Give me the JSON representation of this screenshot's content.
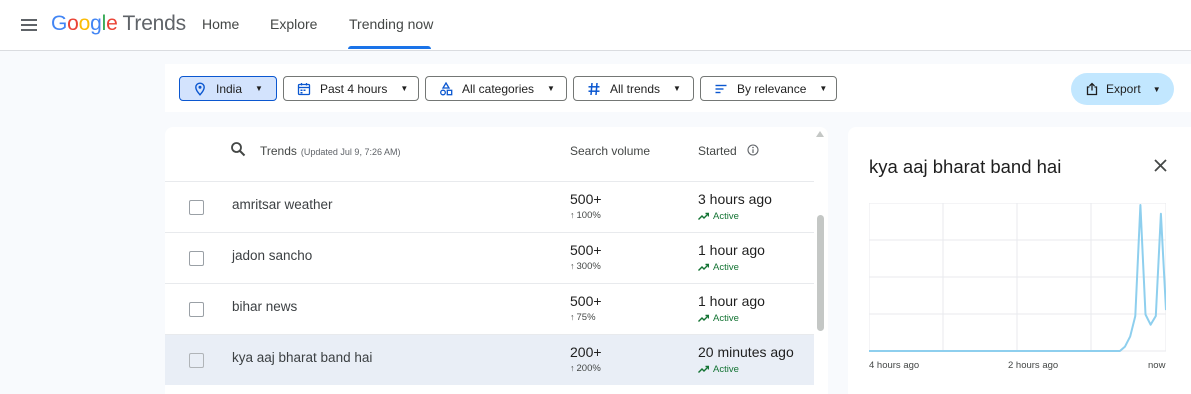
{
  "header": {
    "logo_letters": [
      "G",
      "o",
      "o",
      "g",
      "l",
      "e"
    ],
    "logo_trends": "Trends",
    "nav": [
      {
        "label": "Home",
        "active": false
      },
      {
        "label": "Explore",
        "active": false
      },
      {
        "label": "Trending now",
        "active": true
      }
    ],
    "accent_color": "#1a73e8"
  },
  "filters": {
    "geo": "India",
    "time": "Past 4 hours",
    "category": "All categories",
    "trend_type": "All trends",
    "sort": "By relevance",
    "export_label": "Export",
    "icons": [
      "location-pin-icon",
      "calendar-icon",
      "categories-icon",
      "hashtag-icon",
      "sort-icon",
      "share-icon"
    ]
  },
  "table": {
    "col_trends": "Trends",
    "updated": "(Updated Jul 9, 7:26 AM)",
    "col_volume": "Search volume",
    "col_started": "Started",
    "rows": [
      {
        "term": "amritsar weather",
        "volume": "500+",
        "change": "100%",
        "started": "3 hours ago",
        "status": "Active"
      },
      {
        "term": "jadon sancho",
        "volume": "500+",
        "change": "300%",
        "started": "1 hour ago",
        "status": "Active"
      },
      {
        "term": "bihar news",
        "volume": "500+",
        "change": "75%",
        "started": "1 hour ago",
        "status": "Active"
      },
      {
        "term": "kya aaj bharat band hai",
        "volume": "200+",
        "change": "200%",
        "started": "20 minutes ago",
        "status": "Active"
      }
    ],
    "status_color": "#137333",
    "highlight_color": "#e9eef6"
  },
  "detail": {
    "title": "kya aaj bharat band hai",
    "x_ticks": [
      "4 hours ago",
      "2 hours ago",
      "now"
    ]
  },
  "chart_data": {
    "type": "line",
    "x_labels": [
      "4 hours ago",
      "2 hours ago",
      "now"
    ],
    "values": [
      0,
      0,
      0,
      0,
      0,
      0,
      0,
      0,
      0,
      0,
      0,
      0,
      0,
      0,
      0,
      0,
      0,
      0,
      0,
      0,
      0,
      0,
      0,
      0,
      0,
      0,
      0,
      0,
      0,
      0,
      0,
      0,
      0,
      0,
      0,
      0,
      0,
      0,
      0,
      0,
      0,
      0,
      0,
      0,
      0,
      0,
      0,
      0,
      0,
      0,
      3,
      10,
      24,
      100,
      25,
      18,
      24,
      94,
      28
    ],
    "ylim": [
      0,
      100
    ],
    "grid": true,
    "line_color": "#8ecfee"
  }
}
